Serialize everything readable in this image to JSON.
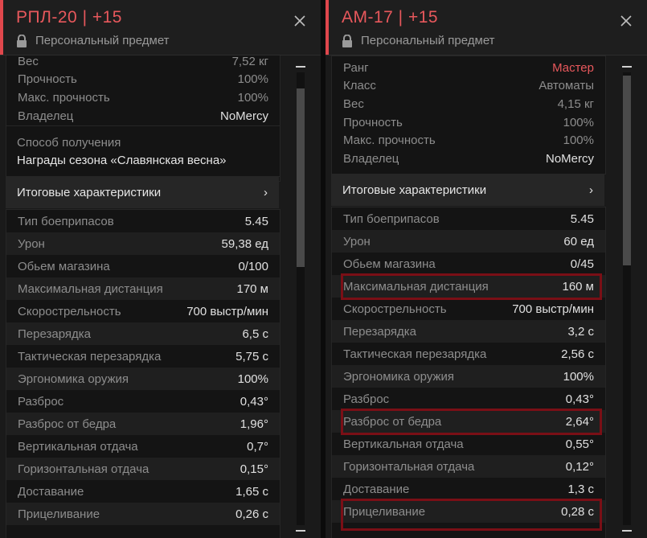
{
  "left": {
    "title": "РПЛ-20 | +15",
    "subtitle": "Персональный предмет",
    "cut_top": {
      "label": "Вес",
      "value": "7,52 кг"
    },
    "top_rows": [
      {
        "label": "Прочность",
        "value": "100%"
      },
      {
        "label": "Макс. прочность",
        "value": "100%"
      },
      {
        "label": "Владелец",
        "value": "NoMercy"
      }
    ],
    "source_label": "Способ получения",
    "source_value": "Награды сезона «Славянская весна»",
    "totals_label": "Итоговые характеристики",
    "totals_arrow": "›",
    "stats": [
      {
        "label": "Тип боеприпасов",
        "value": "5.45"
      },
      {
        "label": "Урон",
        "value": "59,38 ед"
      },
      {
        "label": "Обьем магазина",
        "value": "0/100"
      },
      {
        "label": "Максимальная дистанция",
        "value": "170 м"
      },
      {
        "label": "Скорострельность",
        "value": "700 выстр/мин"
      },
      {
        "label": "Перезарядка",
        "value": "6,5 с"
      },
      {
        "label": "Тактическая перезарядка",
        "value": "5,75 с"
      },
      {
        "label": "Эргономика оружия",
        "value": "100%"
      },
      {
        "label": "Разброс",
        "value": "0,43°"
      },
      {
        "label": "Разброс от бедра",
        "value": "1,96°"
      },
      {
        "label": "Вертикальная отдача",
        "value": "0,7°"
      },
      {
        "label": "Горизонтальная отдача",
        "value": "0,15°"
      },
      {
        "label": "Доставание",
        "value": "1,65 с"
      },
      {
        "label": "Прицеливание",
        "value": "0,26 с"
      }
    ]
  },
  "right": {
    "title": "АМ-17 | +15",
    "subtitle": "Персональный предмет",
    "top_rows": [
      {
        "label": "Ранг",
        "value": "Мастер"
      },
      {
        "label": "Класс",
        "value": "Автоматы"
      },
      {
        "label": "Вес",
        "value": "4,15 кг"
      },
      {
        "label": "Прочность",
        "value": "100%"
      },
      {
        "label": "Макс. прочность",
        "value": "100%"
      },
      {
        "label": "Владелец",
        "value": "NoMercy"
      }
    ],
    "totals_label": "Итоговые характеристики",
    "totals_arrow": "›",
    "stats": [
      {
        "label": "Тип боеприпасов",
        "value": "5.45"
      },
      {
        "label": "Урон",
        "value": "60 ед"
      },
      {
        "label": "Обьем магазина",
        "value": "0/45"
      },
      {
        "label": "Максимальная дистанция",
        "value": "160 м"
      },
      {
        "label": "Скорострельность",
        "value": "700 выстр/мин"
      },
      {
        "label": "Перезарядка",
        "value": "3,2 с"
      },
      {
        "label": "Тактическая перезарядка",
        "value": "2,56 с"
      },
      {
        "label": "Эргономика оружия",
        "value": "100%"
      },
      {
        "label": "Разброс",
        "value": "0,43°"
      },
      {
        "label": "Разброс от бедра",
        "value": "2,64°"
      },
      {
        "label": "Вертикальная отдача",
        "value": "0,55°"
      },
      {
        "label": "Горизонтальная отдача",
        "value": "0,12°"
      },
      {
        "label": "Доставание",
        "value": "1,3 с"
      },
      {
        "label": "Прицеливание",
        "value": "0,28 с"
      }
    ]
  },
  "colors": {
    "accent": "#e8585c",
    "highlight": "#7a0f16",
    "panel": "#1a1a1a"
  }
}
